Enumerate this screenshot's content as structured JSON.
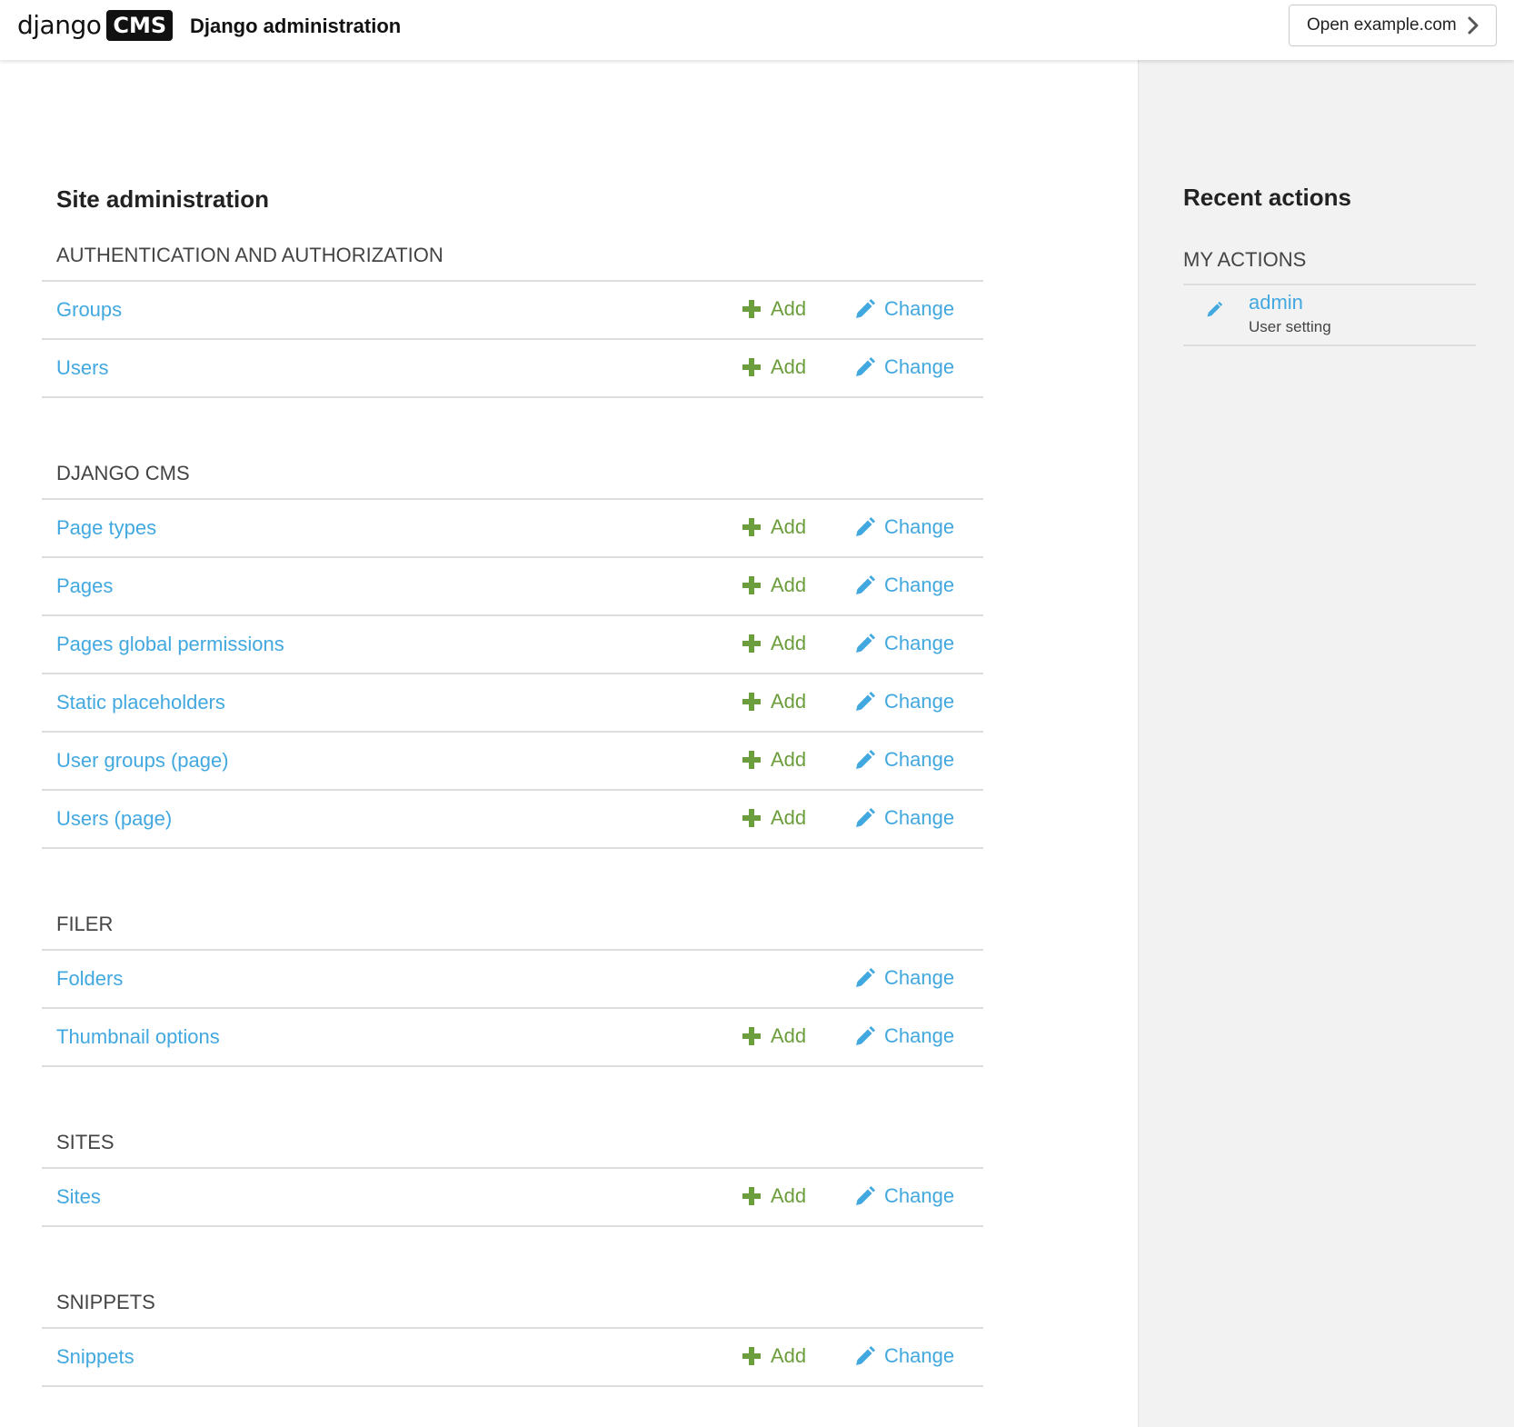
{
  "header": {
    "logo_text": "django",
    "logo_badge": "CMS",
    "title": "Django administration",
    "open_site": "Open example.com"
  },
  "main": {
    "title": "Site administration",
    "add_label": "Add",
    "change_label": "Change",
    "modules": [
      {
        "caption": "AUTHENTICATION AND AUTHORIZATION",
        "models": [
          {
            "name": "Groups",
            "has_add": true
          },
          {
            "name": "Users",
            "has_add": true
          }
        ]
      },
      {
        "caption": "DJANGO CMS",
        "models": [
          {
            "name": "Page types",
            "has_add": true
          },
          {
            "name": "Pages",
            "has_add": true
          },
          {
            "name": "Pages global permissions",
            "has_add": true
          },
          {
            "name": "Static placeholders",
            "has_add": true
          },
          {
            "name": "User groups (page)",
            "has_add": true
          },
          {
            "name": "Users (page)",
            "has_add": true
          }
        ]
      },
      {
        "caption": "FILER",
        "models": [
          {
            "name": "Folders",
            "has_add": false
          },
          {
            "name": "Thumbnail options",
            "has_add": true
          }
        ]
      },
      {
        "caption": "SITES",
        "models": [
          {
            "name": "Sites",
            "has_add": true
          }
        ]
      },
      {
        "caption": "SNIPPETS",
        "models": [
          {
            "name": "Snippets",
            "has_add": true
          }
        ]
      }
    ]
  },
  "sidebar": {
    "title": "Recent actions",
    "subtitle": "MY ACTIONS",
    "actions": [
      {
        "object": "admin",
        "type": "User setting"
      }
    ]
  },
  "colors": {
    "link": "#42a8e0",
    "add": "#6c9e3d",
    "sidebar_bg": "#f2f2f2"
  },
  "icons": {
    "add": "plus-icon",
    "change": "pencil-icon",
    "open_site": "chevron-right-icon"
  }
}
